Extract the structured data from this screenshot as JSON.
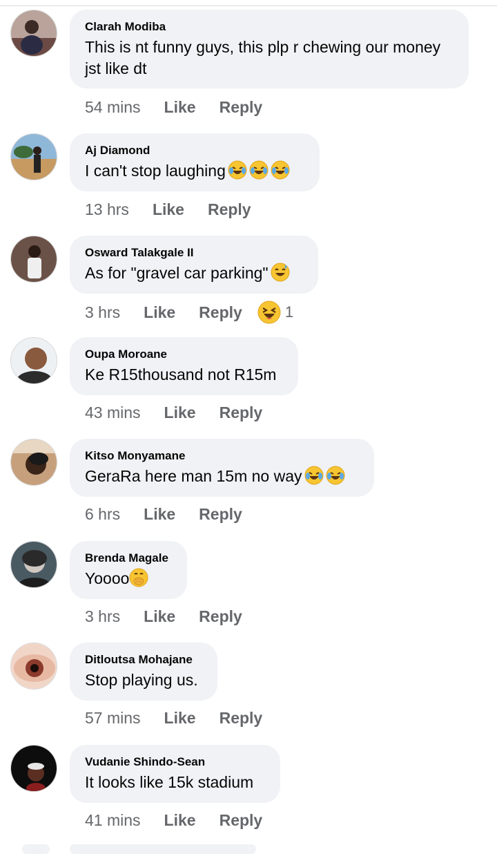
{
  "comments": [
    {
      "name": "Clarah Modiba",
      "text": "This is nt funny guys, this plp r chewing our money jst like dt",
      "time": "54 mins",
      "like": "Like",
      "reply": "Reply"
    },
    {
      "name": "Aj Diamond",
      "text": "I can't stop laughing",
      "time": "13 hrs",
      "like": "Like",
      "reply": "Reply",
      "emojis": [
        "laugh-cry-emoji",
        "laugh-cry-emoji",
        "laugh-cry-emoji"
      ]
    },
    {
      "name": "Osward Talakgale II",
      "text": "As for \"gravel car parking\"",
      "time": "3 hrs",
      "like": "Like",
      "reply": "Reply",
      "emojis": [
        "sweat-smile-emoji"
      ],
      "reaction": {
        "icon": "haha-reaction-icon",
        "count": "1"
      }
    },
    {
      "name": "Oupa Moroane",
      "text": "Ke R15thousand not R15m",
      "time": "43 mins",
      "like": "Like",
      "reply": "Reply"
    },
    {
      "name": "Kitso Monyamane",
      "text": "GeraRa here man 15m no way",
      "time": "6 hrs",
      "like": "Like",
      "reply": "Reply",
      "emojis": [
        "laugh-cry-emoji",
        "laugh-cry-emoji"
      ]
    },
    {
      "name": "Brenda Magale",
      "text": "Yoooo",
      "time": "3 hrs",
      "like": "Like",
      "reply": "Reply",
      "emojis": [
        "hand-over-mouth-emoji"
      ]
    },
    {
      "name": "Ditloutsa Mohajane",
      "text": "Stop playing us.",
      "time": "57 mins",
      "like": "Like",
      "reply": "Reply"
    },
    {
      "name": "Vudanie Shindo-Sean",
      "text": "It looks like 15k stadium",
      "time": "41 mins",
      "like": "Like",
      "reply": "Reply"
    }
  ],
  "colors": {
    "bubble": "#f0f2f5",
    "meta": "#65676b",
    "text": "#050505",
    "emoji": "#f7c531"
  }
}
